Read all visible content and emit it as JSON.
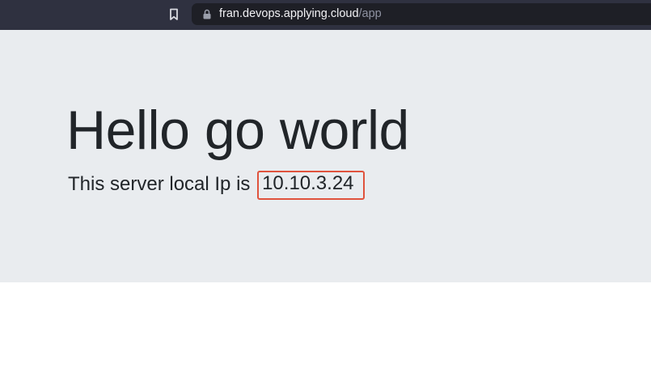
{
  "browser": {
    "url_host": "fran.devops.applying.cloud",
    "url_path": "/app",
    "icons": {
      "bookmark": "bookmark-icon",
      "lock": "lock-icon"
    }
  },
  "page": {
    "title": "Hello go world",
    "lead_prefix": "This server local Ip is",
    "ip_address": "10.10.3.24",
    "colors": {
      "jumbotron_background": "#e9ecef",
      "text": "#212529",
      "highlight_border": "#e0533d"
    }
  }
}
